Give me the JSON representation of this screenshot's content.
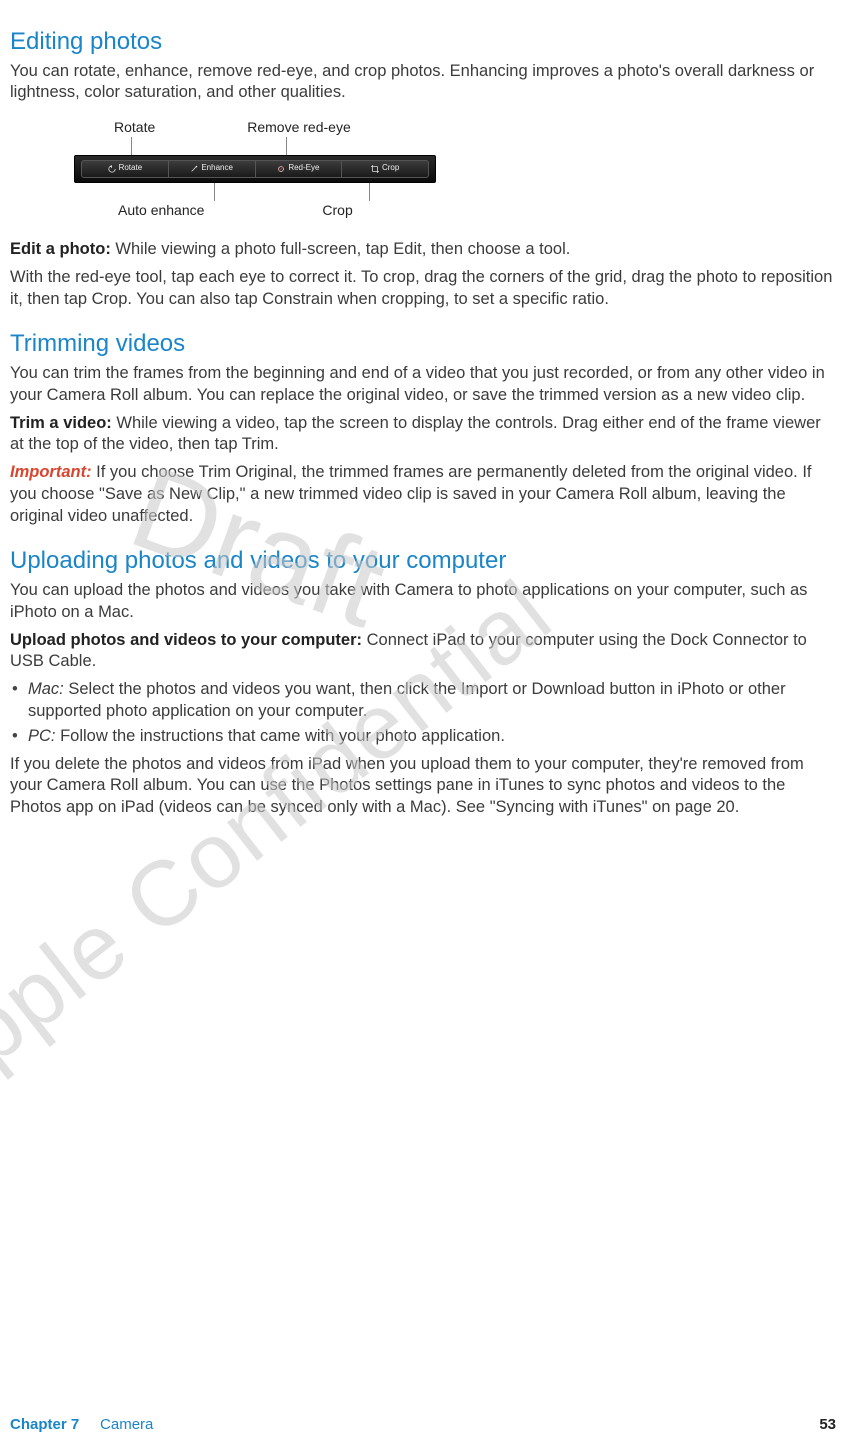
{
  "sections": {
    "editing": {
      "heading": "Editing photos",
      "intro": "You can rotate, enhance, remove red-eye, and crop photos. Enhancing improves a photo's overall darkness or lightness, color saturation, and other qualities.",
      "callouts": {
        "rotate": "Rotate",
        "remove_redeye": "Remove red-eye",
        "auto_enhance": "Auto enhance",
        "crop": "Crop"
      },
      "toolbar": {
        "rotate": "Rotate",
        "enhance": "Enhance",
        "redeye": "Red-Eye",
        "crop": "Crop"
      },
      "edit_label": "Edit a photo:  ",
      "edit_text": "While viewing a photo full-screen, tap Edit, then choose a tool.",
      "redeye_text": "With the red-eye tool, tap each eye to correct it. To crop, drag the corners of the grid, drag the photo to reposition it, then tap Crop. You can also tap Constrain when cropping, to set a specific ratio."
    },
    "trimming": {
      "heading": "Trimming videos",
      "intro": "You can trim the frames from the beginning and end of a video that you just recorded, or from any other video in your Camera Roll album. You can replace the original video, or save the trimmed version as a new video clip.",
      "trim_label": "Trim a video:  ",
      "trim_text": "While viewing a video, tap the screen to display the controls. Drag either end of the frame viewer at the top of the video, then tap Trim.",
      "important_label": "Important:  ",
      "important_text": "If you choose Trim Original, the trimmed frames are permanently deleted from the original video. If you choose \"Save as New Clip,\" a new trimmed video clip is saved in your Camera Roll album, leaving the original video unaffected."
    },
    "uploading": {
      "heading": "Uploading photos and videos to your computer",
      "intro": "You can upload the photos and videos you take with Camera to photo applications on your computer, such as iPhoto on a Mac.",
      "upload_label": "Upload photos and videos to your computer:  ",
      "upload_text": "Connect iPad to your computer using the Dock Connector to USB Cable.",
      "mac_label": "Mac:  ",
      "mac_text": "Select the photos and videos you want, then click the Import or Download button in iPhoto or other supported photo application on your computer.",
      "pc_label": "PC:  ",
      "pc_text": "Follow the instructions that came with your photo application.",
      "after": "If you delete the photos and videos from iPad when you upload them to your computer, they're removed from your Camera Roll album. You can use the Photos settings pane in iTunes to sync photos and videos to the Photos app on iPad (videos can be synced only with a Mac). See \"Syncing with iTunes\" on page 20."
    }
  },
  "watermarks": {
    "draft": "Draft",
    "confidential": "Apple Confidential"
  },
  "footer": {
    "chapter": "Chapter 7",
    "name": "Camera",
    "page": "53"
  }
}
